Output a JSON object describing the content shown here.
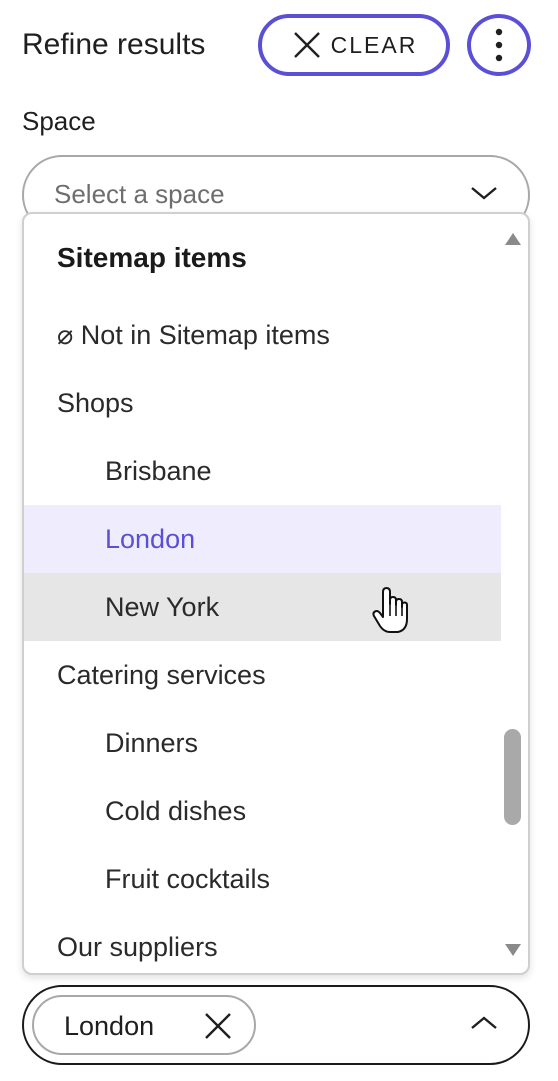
{
  "header": {
    "title": "Refine results",
    "clear_label": "CLEAR",
    "clear_icon": "close-icon",
    "more_icon": "more-vertical-icon"
  },
  "space_filter": {
    "label": "Space",
    "placeholder": "Select a space",
    "chevron_icon": "chevron-down-icon"
  },
  "dropdown": {
    "heading": "Sitemap items",
    "items": [
      {
        "label": "⌀ Not in Sitemap items",
        "level": 0,
        "state": "normal"
      },
      {
        "label": "Shops",
        "level": 0,
        "state": "normal"
      },
      {
        "label": "Brisbane",
        "level": 1,
        "state": "normal"
      },
      {
        "label": "London",
        "level": 1,
        "state": "selected"
      },
      {
        "label": "New York",
        "level": 1,
        "state": "hovered"
      },
      {
        "label": "Catering services",
        "level": 0,
        "state": "normal"
      },
      {
        "label": "Dinners",
        "level": 1,
        "state": "normal"
      },
      {
        "label": "Cold dishes",
        "level": 1,
        "state": "normal"
      },
      {
        "label": "Fruit cocktails",
        "level": 1,
        "state": "normal"
      },
      {
        "label": "Our suppliers",
        "level": 0,
        "state": "normal"
      }
    ]
  },
  "selected_chip": {
    "label": "London",
    "remove_icon": "close-icon",
    "collapse_icon": "chevron-up-icon"
  },
  "colors": {
    "accent": "#5b4fd6",
    "selected_bg": "#efedfd",
    "hover_bg": "#e6e6e6"
  }
}
